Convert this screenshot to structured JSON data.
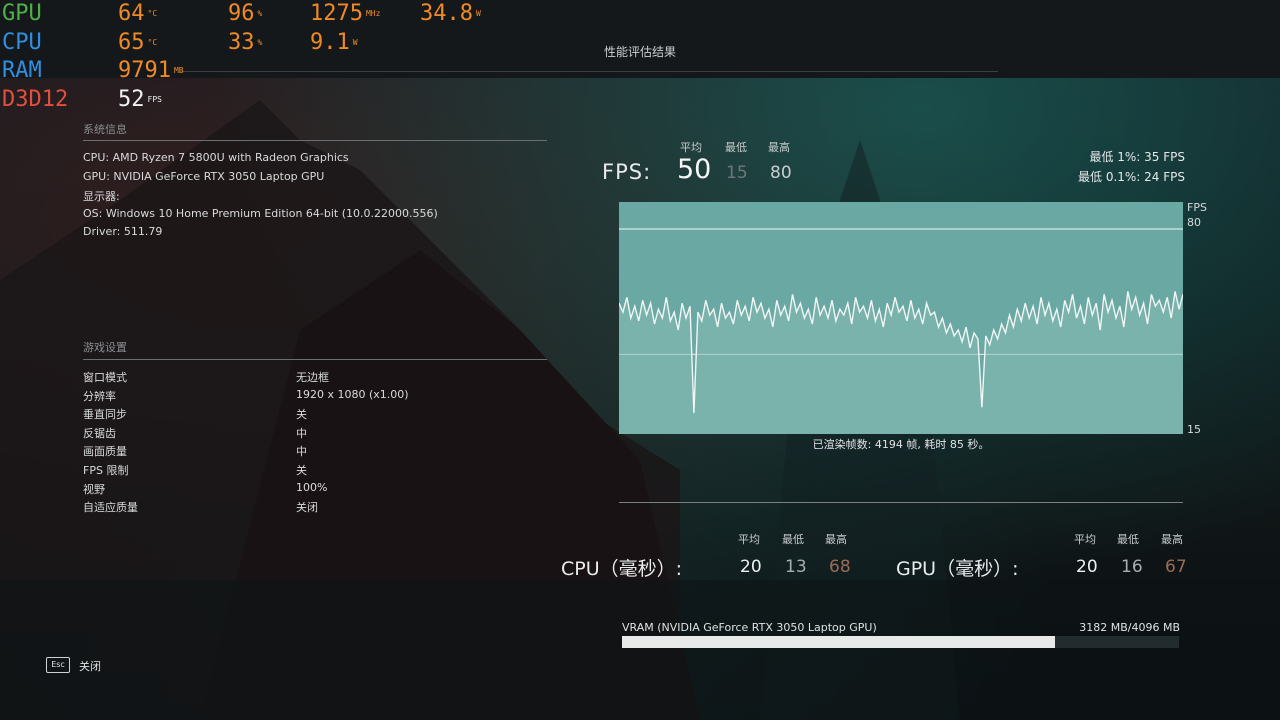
{
  "osd": {
    "rows": [
      {
        "label": "GPU",
        "label_color": "#4fb04a",
        "a": "64",
        "a_unit": "°C",
        "b": "96",
        "b_unit": "%",
        "c": "1275",
        "c_unit": "MHz",
        "d": "34.8",
        "d_unit": "W"
      },
      {
        "label": "CPU",
        "label_color": "#2f8fe0",
        "a": "65",
        "a_unit": "°C",
        "b": "33",
        "b_unit": "%",
        "c": "9.1",
        "c_unit": "W"
      },
      {
        "label": "RAM",
        "label_color": "#2f8fe0",
        "a": "9791",
        "a_unit": "MB"
      },
      {
        "label": "D3D12",
        "label_color": "#e0503a",
        "a": "52",
        "a_unit": "FPS"
      }
    ]
  },
  "page_title": "性能评估结果",
  "system": {
    "title": "系统信息",
    "lines": [
      "CPU: AMD Ryzen 7 5800U with Radeon Graphics",
      "GPU: NVIDIA GeForce RTX 3050 Laptop GPU",
      "显示器:",
      "OS: Windows 10 Home Premium Edition 64-bit (10.0.22000.556)",
      "Driver: 511.79"
    ]
  },
  "settings": {
    "title": "游戏设置",
    "rows": [
      {
        "name": "窗口模式",
        "value": "无边框"
      },
      {
        "name": "分辨率",
        "value": "1920 x 1080 (x1.00)"
      },
      {
        "name": "垂直同步",
        "value": "关"
      },
      {
        "name": "反锯齿",
        "value": "中"
      },
      {
        "name": "画面质量",
        "value": "中"
      },
      {
        "name": "FPS 限制",
        "value": "关"
      },
      {
        "name": "视野",
        "value": "100%"
      },
      {
        "name": "自适应质量",
        "value": "关闭"
      }
    ]
  },
  "fps": {
    "label": "FPS:",
    "head_avg": "平均",
    "head_min": "最低",
    "head_max": "最高",
    "avg": "50",
    "min": "15",
    "max": "80",
    "low1": "最低 1%:  35 FPS",
    "low01": "最低 0.1%:  24 FPS"
  },
  "chart_data": {
    "type": "line",
    "title": "",
    "ylabel": "FPS",
    "ylim": [
      15,
      80
    ],
    "y_ticks": [
      "80",
      "15"
    ],
    "colors": {
      "background": "#6aa8a3",
      "line": "#f2f6f6",
      "grid": "#d8e6e4"
    },
    "series": [
      {
        "values": [
          55,
          52,
          57,
          50,
          54,
          49,
          56,
          51,
          55,
          48,
          53,
          50,
          57,
          49,
          52,
          46,
          55,
          50,
          54,
          18,
          52,
          49,
          56,
          51,
          53,
          47,
          55,
          50,
          52,
          48,
          56,
          51,
          54,
          49,
          57,
          52,
          55,
          50,
          53,
          47,
          56,
          51,
          54,
          49,
          58,
          52,
          55,
          50,
          53,
          48,
          57,
          51,
          54,
          50,
          56,
          49,
          53,
          51,
          55,
          48,
          57,
          52,
          54,
          50,
          56,
          49,
          53,
          47,
          55,
          51,
          57,
          52,
          54,
          49,
          56,
          50,
          53,
          48,
          55,
          51,
          52,
          47,
          50,
          45,
          48,
          44,
          46,
          42,
          47,
          40,
          45,
          43,
          20,
          44,
          41,
          46,
          43,
          48,
          45,
          51,
          47,
          53,
          49,
          55,
          50,
          54,
          48,
          57,
          51,
          55,
          49,
          53,
          47,
          56,
          52,
          58,
          50,
          54,
          48,
          57,
          51,
          55,
          46,
          58,
          52,
          56,
          50,
          54,
          47,
          59,
          53,
          57,
          51,
          55,
          48,
          58,
          54,
          56,
          52,
          57,
          50,
          59,
          53,
          58
        ]
      }
    ]
  },
  "rendered": "已渲染帧数: 4194 帧, 耗时 85 秒。",
  "cpu": {
    "label": "CPU（毫秒）:",
    "head_avg": "平均",
    "head_min": "最低",
    "head_max": "最高",
    "avg": "20",
    "min": "13",
    "max": "68"
  },
  "gpu": {
    "label": "GPU（毫秒）:",
    "head_avg": "平均",
    "head_min": "最低",
    "head_max": "最高",
    "avg": "20",
    "min": "16",
    "max": "67"
  },
  "vram": {
    "label": "VRAM (NVIDIA GeForce RTX 3050 Laptop GPU)",
    "value": "3182 MB/4096 MB",
    "fraction": 0.777
  },
  "footer": {
    "key": "Esc",
    "label": "关闭"
  }
}
